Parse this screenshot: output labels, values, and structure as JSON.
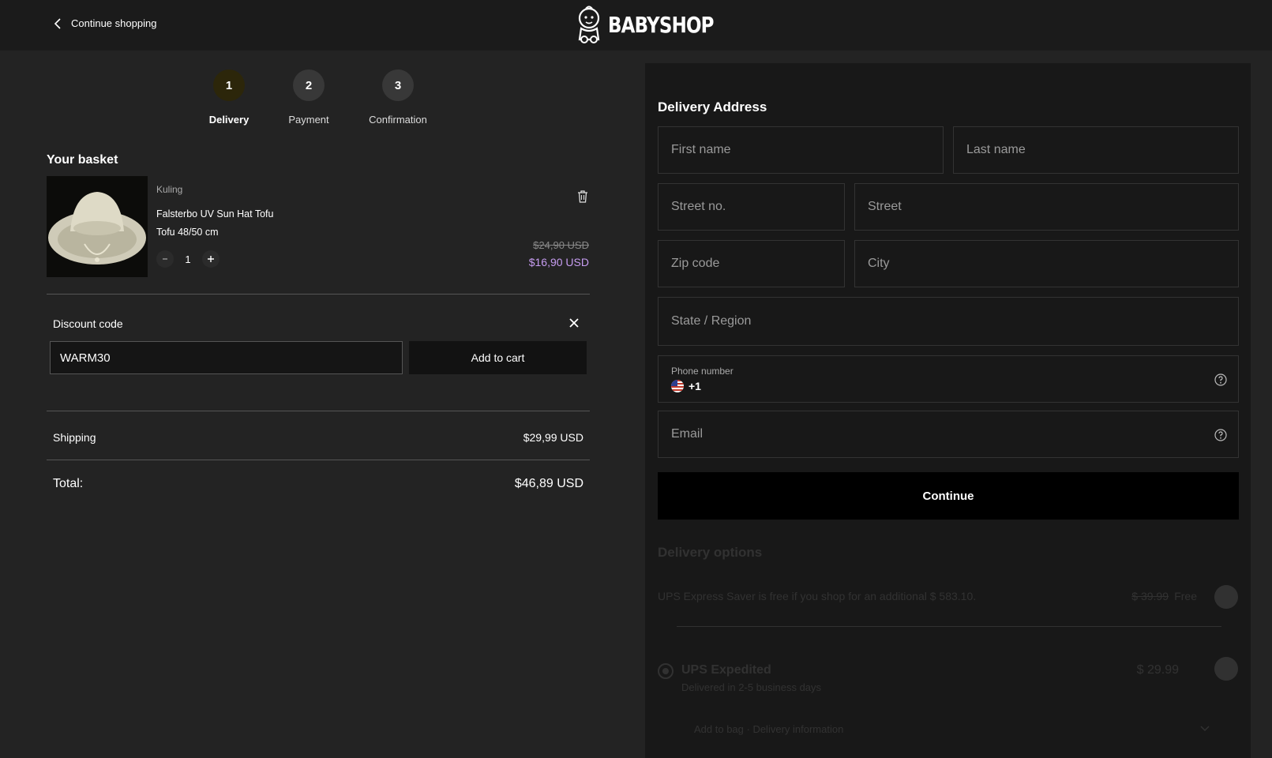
{
  "header": {
    "back_label": "Continue shopping",
    "logo_text": "BABYSHOP"
  },
  "steps": [
    {
      "number": "1",
      "label": "Delivery",
      "active": true
    },
    {
      "number": "2",
      "label": "Payment",
      "active": false
    },
    {
      "number": "3",
      "label": "Confirmation",
      "active": false
    }
  ],
  "basket": {
    "title": "Your basket",
    "item": {
      "brand": "Kuling",
      "name": "Falsterbo UV Sun Hat Tofu",
      "variant": "Tofu 48/50 cm",
      "quantity": "1",
      "price_old": "$24,90 USD",
      "price_new": "$16,90 USD"
    },
    "discount": {
      "label": "Discount code",
      "value": "WARM30",
      "button": "Add to cart"
    },
    "shipping_label": "Shipping",
    "shipping_value": "$29,99 USD",
    "total_label": "Total:",
    "total_value": "$46,89 USD"
  },
  "form": {
    "title": "Delivery Address",
    "first_name": "First name",
    "last_name": "Last name",
    "street_no": "Street no.",
    "street": "Street",
    "zip": "Zip code",
    "city": "City",
    "state": "State / Region",
    "phone_label": "Phone number",
    "phone_prefix": "+1",
    "email": "Email",
    "continue": "Continue"
  },
  "delivery_options": {
    "title": "Delivery options",
    "free_note": "UPS Express Saver is free if you shop for an additional $ 583.10.",
    "free_strike": "$ 39.99",
    "free_label": "Free",
    "option_name": "UPS Expedited",
    "option_sub": "Delivered in 2-5 business days",
    "option_price": "$ 29.99",
    "option_more": "Add to bag · Delivery information"
  },
  "colors": {
    "accent_price": "#c69cf0",
    "active_step": "#2c260a",
    "panel": "#181818",
    "background": "#232323"
  }
}
